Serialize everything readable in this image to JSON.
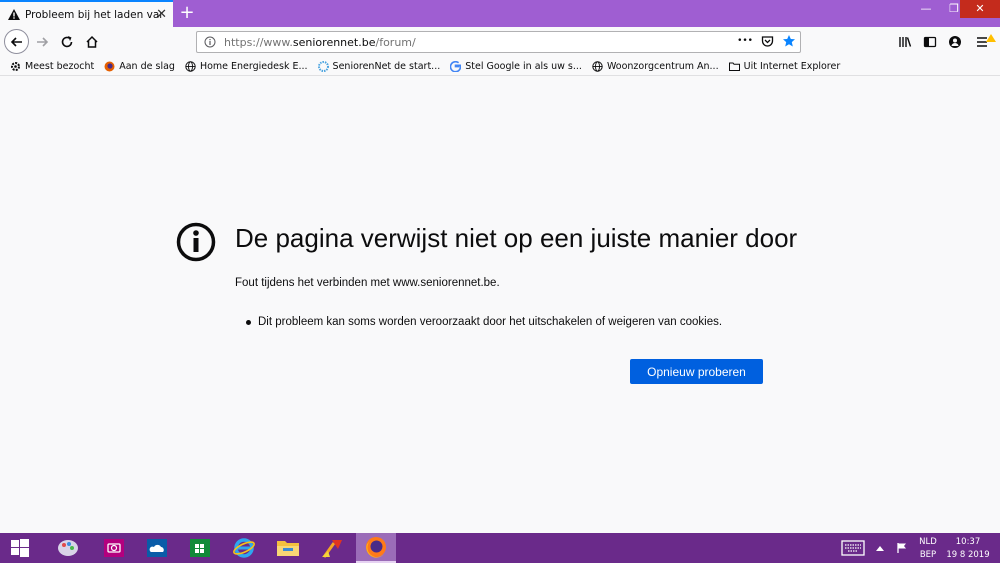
{
  "tab": {
    "title": "Probleem bij het laden van de p",
    "close": "✕"
  },
  "window": {
    "minimize": "—",
    "maximize": "❐",
    "close": "✕"
  },
  "urlbar": {
    "prefix": "https://www.",
    "host": "seniorennet.be",
    "path": "/forum/",
    "more": "•••"
  },
  "bookmarks": [
    {
      "label": "Meest bezocht",
      "icon": "gear-icon"
    },
    {
      "label": "Aan de slag",
      "icon": "firefox-icon"
    },
    {
      "label": "Home  Energiedesk  E...",
      "icon": "globe-icon"
    },
    {
      "label": "SeniorenNet   de start...",
      "icon": "seniorennet-icon"
    },
    {
      "label": "Stel Google in als uw s...",
      "icon": "google-icon"
    },
    {
      "label": "Woonzorgcentrum An...",
      "icon": "globe-icon"
    },
    {
      "label": "Uit Internet Explorer",
      "icon": "folder-icon"
    }
  ],
  "error": {
    "title": "De pagina verwijst niet op een juiste manier door",
    "description": "Fout tijdens het verbinden met www.seniorennet.be.",
    "bullet": "Dit probleem kan soms worden veroorzaakt door het uitschakelen of weigeren van cookies.",
    "retry_label": "Opnieuw proberen"
  },
  "tray": {
    "lang_top": "NLD",
    "lang_bottom": "BEP",
    "time": "10:37",
    "date": "19 8 2019"
  },
  "colors": {
    "titlebar": "#9f5ed2",
    "taskbar": "#6a2a8a",
    "accent": "#0060df",
    "close": "#c42b1c"
  }
}
